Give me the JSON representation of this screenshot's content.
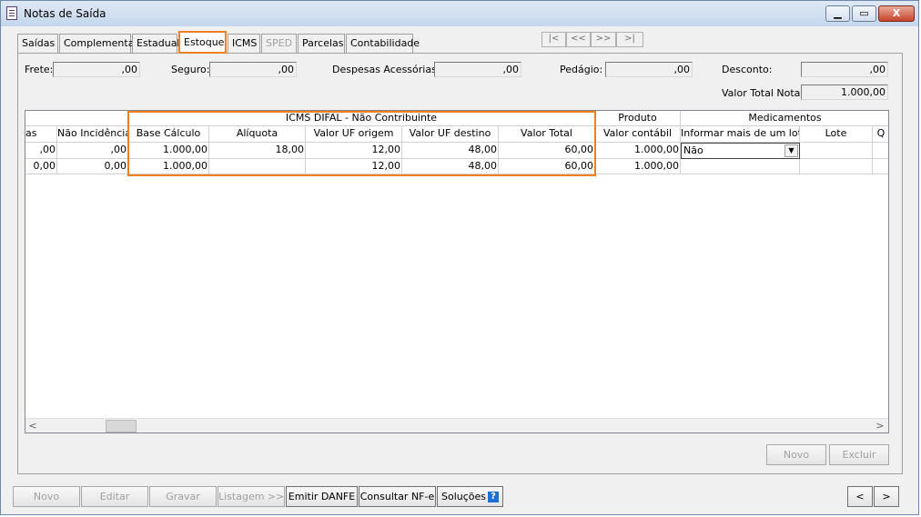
{
  "window": {
    "title": "Notas de Saída",
    "min_label": "▁",
    "max_label": "▭",
    "close_label": "X"
  },
  "tabs": [
    "Saídas",
    "Complementar",
    "Estadual",
    "Estoque",
    "ICMS",
    "SPED",
    "Parcelas",
    "Contabilidade"
  ],
  "record_nav": [
    "|<",
    "<<",
    ">>",
    ">|"
  ],
  "fields": {
    "frete": {
      "label": "Frete:",
      "value": ",00"
    },
    "seguro": {
      "label": "Seguro:",
      "value": ",00"
    },
    "despesas": {
      "label": "Despesas Acessórias:",
      "value": ",00"
    },
    "pedagio": {
      "label": "Pedágio:",
      "value": ",00"
    },
    "desconto": {
      "label": "Desconto:",
      "value": ",00"
    },
    "valor_total_nota": {
      "label": "Valor Total Nota:",
      "value": "1.000,00"
    }
  },
  "grid": {
    "group_difal": "ICMS DIFAL - Não Contribuinte",
    "group_produto": "Produto",
    "group_medicamentos": "Medicamentos",
    "columns": [
      "as",
      "Não Incidência",
      "Base Cálculo",
      "Alíquota",
      "Valor UF origem",
      "Valor UF destino",
      "Valor Total",
      "Valor contábil",
      "Informar mais de um lote",
      "Lote",
      "Q"
    ],
    "rows": [
      [
        ",00",
        ",00",
        "1.000,00",
        "18,00",
        "12,00",
        "48,00",
        "60,00",
        "1.000,00",
        "Não",
        "",
        ""
      ],
      [
        "0,00",
        "0,00",
        "1.000,00",
        "",
        "12,00",
        "48,00",
        "60,00",
        "1.000,00",
        "",
        "",
        ""
      ]
    ]
  },
  "scroll": {
    "left": "<",
    "right": ">"
  },
  "panel_buttons": {
    "novo": "Novo",
    "excluir": "Excluir"
  },
  "bottom_buttons": {
    "novo": "Novo",
    "editar": "Editar",
    "gravar": "Gravar",
    "listagem": "Listagem >>",
    "emitir": "Emitir DANFE",
    "consultar": "Consultar NF-e",
    "solucoes": "Soluções",
    "help": "?",
    "prev": "<",
    "next": ">"
  }
}
